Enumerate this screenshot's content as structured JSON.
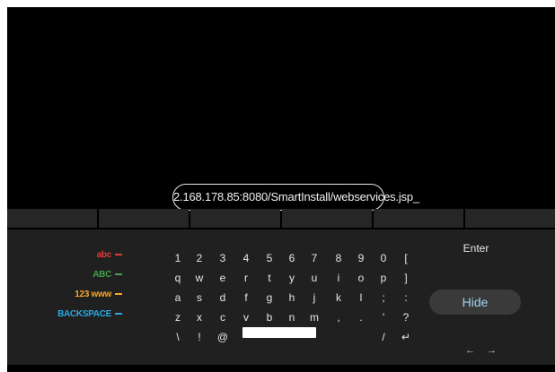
{
  "url_input": {
    "value": "2.168.178.85:8080/SmartInstall/webservices.jsp_"
  },
  "modes": [
    {
      "label": "abc",
      "color": "#e53935"
    },
    {
      "label": "ABC",
      "color": "#43a047"
    },
    {
      "label": "123 www",
      "color": "#f9a825"
    },
    {
      "label": "BACKSPACE",
      "color": "#29a8e0"
    }
  ],
  "keys": [
    [
      "1",
      "2",
      "3",
      "4",
      "5",
      "6",
      "7",
      "8",
      "9",
      "0",
      "["
    ],
    [
      "q",
      "w",
      "e",
      "r",
      "t",
      "y",
      "u",
      "i",
      "o",
      "p",
      "]"
    ],
    [
      "a",
      "s",
      "d",
      "f",
      "g",
      "h",
      "j",
      "k",
      "l",
      ";",
      ":"
    ],
    [
      "z",
      "x",
      "c",
      "v",
      "b",
      "n",
      "m",
      ",",
      ".",
      "'",
      "?"
    ],
    [
      "\\",
      "!",
      "@",
      "/",
      "↵"
    ]
  ],
  "actions": {
    "enter": "Enter",
    "hide": "Hide",
    "left_arrow": "←",
    "right_arrow": "→"
  }
}
